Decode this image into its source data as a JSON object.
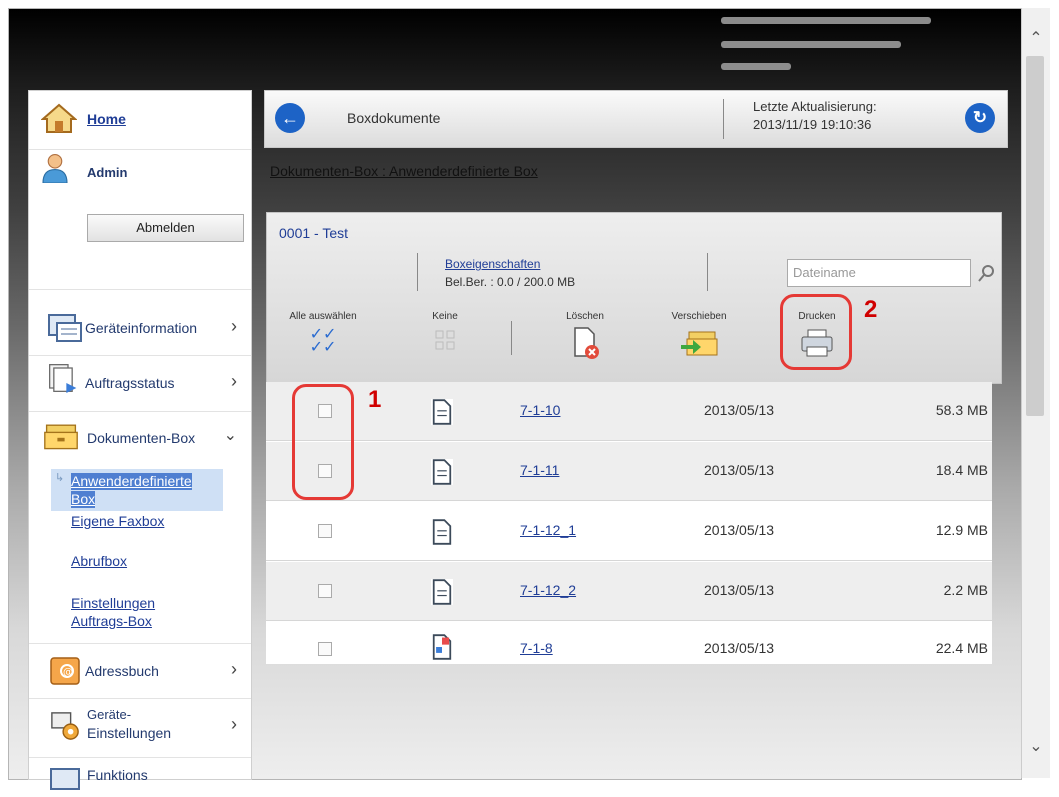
{
  "sidebar": {
    "home": "Home",
    "user": "Admin",
    "logout": "Abmelden",
    "items": [
      {
        "label": "Geräteinformation",
        "icon": "device-info-icon"
      },
      {
        "label": "Auftragsstatus",
        "icon": "job-status-icon"
      },
      {
        "label": "Dokumenten-Box",
        "icon": "document-box-icon"
      },
      {
        "label": "Adressbuch",
        "icon": "address-book-icon"
      },
      {
        "label": "Geräte-Einstellungen",
        "icon": "device-settings-icon"
      },
      {
        "label": "Funktions",
        "icon": "function-icon"
      }
    ],
    "subitems": [
      "Anwenderdefinierte Box",
      "Eigene Faxbox",
      "Abrufbox",
      "Einstellungen Auftrags-Box"
    ],
    "item5_line1": "Geräte-",
    "item5_line2": "Einstellungen",
    "sub0_line1": "Anwenderdefinierte",
    "sub0_line2": "Box",
    "sub3_line1": "Einstellungen",
    "sub3_line2": "Auftrags-Box"
  },
  "header": {
    "title": "Boxdokumente",
    "updated_label": "Letzte Aktualisierung:",
    "updated_value": "2013/11/19 19:10:36"
  },
  "breadcrumb": "Dokumenten-Box : Anwenderdefinierte Box",
  "box": {
    "name": "0001 - Test",
    "properties_link": "Boxeigenschaften",
    "usage": "Bel.Ber. : 0.0 / 200.0 MB",
    "search_placeholder": "Dateiname"
  },
  "toolbar": {
    "select_all": "Alle auswählen",
    "none": "Keine",
    "delete": "Löschen",
    "move": "Verschieben",
    "print": "Drucken"
  },
  "files": [
    {
      "name": "7-1-10",
      "date": "2013/05/13",
      "size": "58.3 MB"
    },
    {
      "name": "7-1-11",
      "date": "2013/05/13",
      "size": "18.4 MB"
    },
    {
      "name": "7-1-12_1",
      "date": "2013/05/13",
      "size": "12.9 MB"
    },
    {
      "name": "7-1-12_2",
      "date": "2013/05/13",
      "size": "2.2 MB"
    },
    {
      "name": "7-1-8",
      "date": "2013/05/13",
      "size": "22.4 MB"
    }
  ],
  "annotations": {
    "one": "1",
    "two": "2"
  },
  "colors": {
    "accent": "#1d63c6",
    "highlight": "#e53935",
    "link": "#1f3d96"
  }
}
